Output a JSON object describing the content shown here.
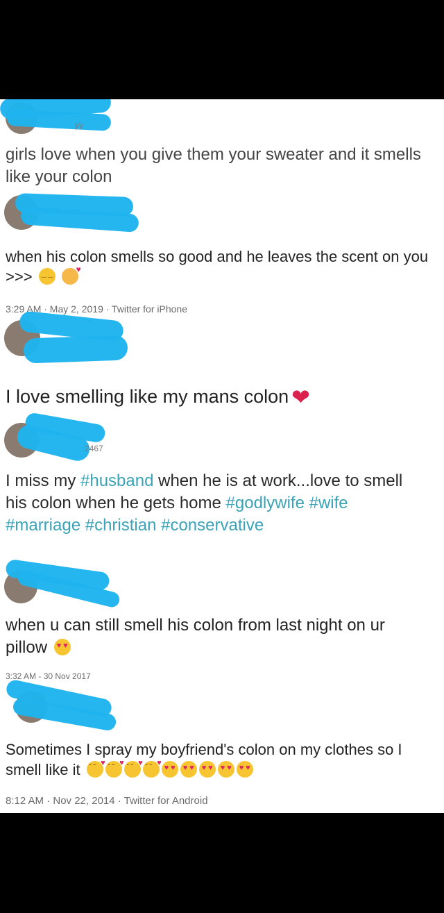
{
  "tweets": [
    {
      "handle_fragment": "yy",
      "text": "girls love when you give them your sweater and it smells like your colon"
    },
    {
      "text": "when his colon smells so good and he leaves the scent on you >>>",
      "emojis": [
        "relieved-face-icon",
        "smiling-face-with-hearts-icon"
      ],
      "meta": "3:29 AM · May 2, 2019 · Twitter for iPhone"
    },
    {
      "text": "I love smelling like my mans colon",
      "emojis": [
        "sparkling-heart-icon"
      ]
    },
    {
      "handle_fragment": "2467",
      "segments": [
        "I miss my ",
        "#husband",
        " when he is at work...love to smell his colon when he gets home "
      ],
      "hashtags": [
        "#godlywife",
        "#wife",
        "#marriage",
        "#christian",
        "#conservative"
      ],
      "hashtag_color": "#3aa3b8"
    },
    {
      "text": "when u can still smell his colon from last night on ur pillow",
      "emojis": [
        "heart-eyes-icon"
      ],
      "meta": "3:32 AM - 30 Nov 2017"
    },
    {
      "text": "Sometimes I spray my boyfriend's colon on my clothes so I smell like it",
      "emojis": [
        "face-blowing-kiss-icon",
        "face-blowing-kiss-icon",
        "face-blowing-kiss-icon",
        "face-blowing-kiss-icon",
        "heart-eyes-icon",
        "heart-eyes-icon",
        "heart-eyes-icon",
        "heart-eyes-icon",
        "heart-eyes-icon"
      ],
      "meta": "8:12 AM · Nov 22, 2014 · Twitter for Android"
    }
  ],
  "colors": {
    "redaction": "#1fb4ee",
    "background": "#ffffff",
    "frame": "#000000"
  }
}
